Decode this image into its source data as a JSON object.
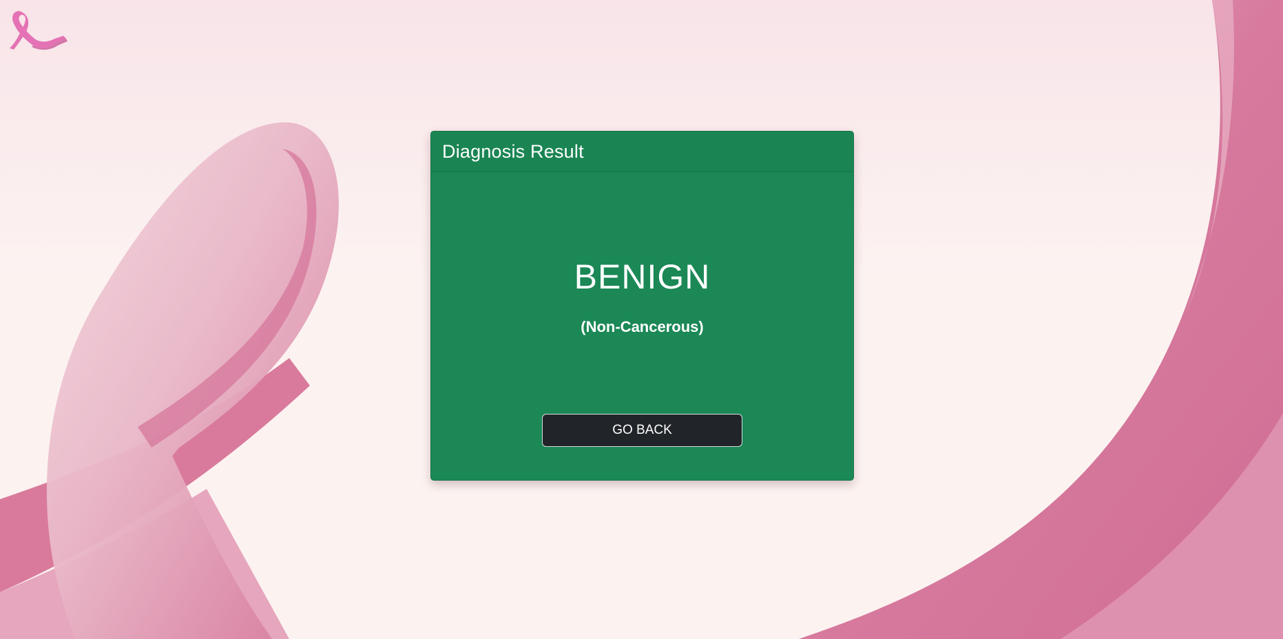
{
  "logo": {
    "icon": "pink-ribbon-icon"
  },
  "card": {
    "title": "Diagnosis Result",
    "result": "BENIGN",
    "result_detail": "(Non-Cancerous)",
    "back_button_label": "GO BACK"
  },
  "colors": {
    "card_background": "#1b8856",
    "button_background": "#212529",
    "page_background": "#fcf3f1",
    "ribbon_pink": "#d97a9c"
  }
}
